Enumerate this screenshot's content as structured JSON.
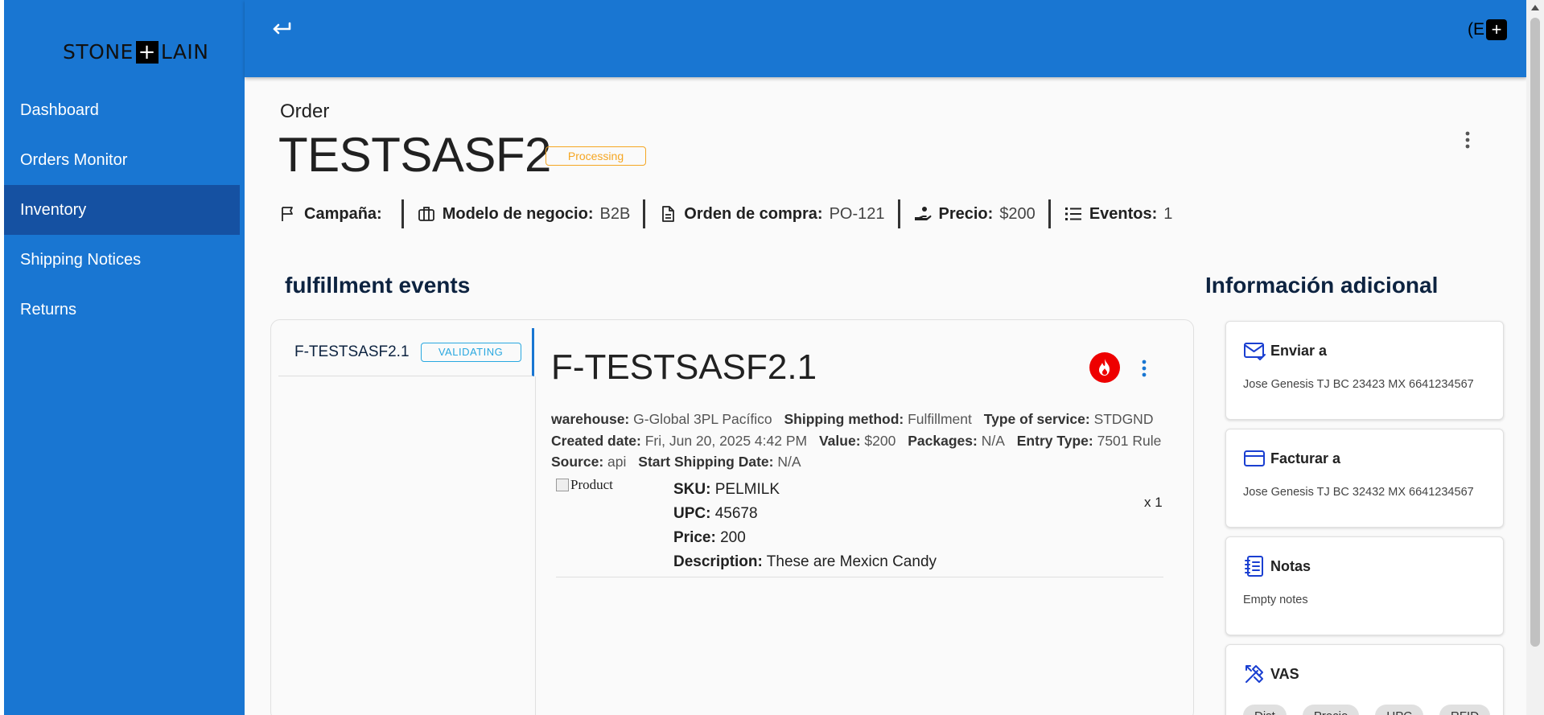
{
  "sidebar": {
    "logo_left": "STONE",
    "logo_mark": "+",
    "logo_right": "LAIN",
    "items": [
      {
        "label": "Dashboard"
      },
      {
        "label": "Orders Monitor"
      },
      {
        "label": "Inventory"
      },
      {
        "label": "Shipping Notices"
      },
      {
        "label": "Returns"
      }
    ],
    "active_item": "Inventory"
  },
  "topbar": {
    "back_icon": "return-arrow-icon",
    "user_text": "(E",
    "user_mark": "+"
  },
  "order": {
    "label": "Order",
    "id": "TESTSASF2",
    "status": "Processing",
    "meta": [
      {
        "icon": "flag-icon",
        "key": "Campaña:",
        "value": ""
      },
      {
        "icon": "briefcase-icon",
        "key": "Modelo de negocio:",
        "value": "B2B"
      },
      {
        "icon": "document-icon",
        "key": "Orden de compra:",
        "value": "PO-121"
      },
      {
        "icon": "hand-coin-icon",
        "key": "Precio:",
        "value": "$200"
      },
      {
        "icon": "list-icon",
        "key": "Eventos:",
        "value": "1"
      }
    ]
  },
  "fulfillment": {
    "section_title": "fulfillment events",
    "list": [
      {
        "label": "F-TESTSASF2.1",
        "status": "VALIDATING"
      }
    ],
    "selected": {
      "title": "F-TESTSASF2.1",
      "details_line1": [
        {
          "key": "warehouse:",
          "value": "G-Global 3PL Pacífico"
        },
        {
          "key": "Shipping method:",
          "value": "Fulfillment"
        },
        {
          "key": "Type of service:",
          "value": "STDGND"
        }
      ],
      "details_line2": [
        {
          "key": "Created date:",
          "value": "Fri, Jun 20, 2025 4:42 PM"
        },
        {
          "key": "Value:",
          "value": "$200"
        },
        {
          "key": "Packages:",
          "value": "N/A"
        },
        {
          "key": "Entry Type:",
          "value": "7501 Rule"
        }
      ],
      "details_line3": [
        {
          "key": "Source:",
          "value": "api"
        },
        {
          "key": "Start Shipping Date:",
          "value": "N/A"
        }
      ],
      "product": {
        "image_alt": "Product",
        "sku_label": "SKU:",
        "sku": "PELMILK",
        "upc_label": "UPC:",
        "upc": "45678",
        "price_label": "Price:",
        "price": "200",
        "description_label": "Description:",
        "description": "These are Mexicn Candy",
        "quantity": "x 1"
      }
    }
  },
  "additional": {
    "section_title": "Información adicional",
    "ship_to": {
      "title": "Enviar a",
      "body": "Jose Genesis TJ BC 23423 MX 6641234567"
    },
    "bill_to": {
      "title": "Facturar a",
      "body": "Jose Genesis TJ BC 32432 MX 6641234567"
    },
    "notes": {
      "title": "Notas",
      "body": "Empty notes"
    },
    "vas": {
      "title": "VAS",
      "chips": [
        "Dist",
        "Precio",
        "UPC",
        "RFID"
      ]
    }
  },
  "colors": {
    "primary": "#1976d2",
    "sidebar_active": "#1551a2",
    "processing": "#f5a623",
    "validating": "#29a8e0",
    "fire": "#ee0000",
    "info_icon": "#1a3fd1"
  }
}
